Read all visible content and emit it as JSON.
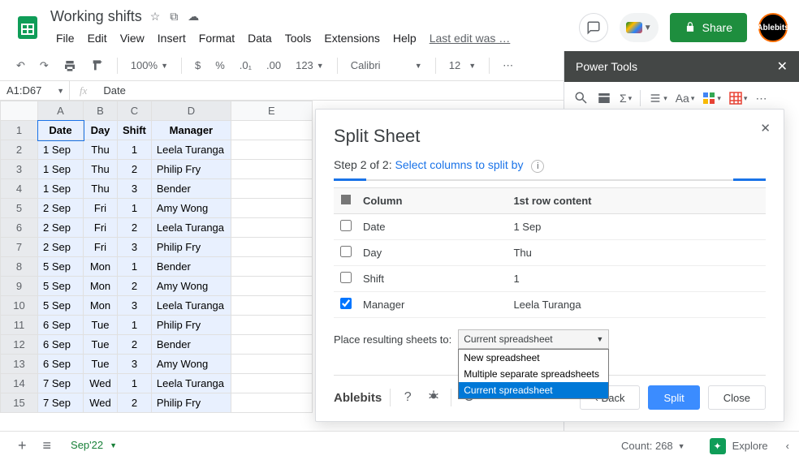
{
  "doc": {
    "title": "Working shifts",
    "last_edit": "Last edit was …"
  },
  "menubar": [
    "File",
    "Edit",
    "View",
    "Insert",
    "Format",
    "Data",
    "Tools",
    "Extensions",
    "Help"
  ],
  "share": "Share",
  "avatar": "Ablebits",
  "toolbar": {
    "zoom": "100%",
    "font": "Calibri",
    "size": "12",
    "currency": "$",
    "percent": "%",
    "dec_dec": ".0₁",
    "dec_inc": ".00",
    "numfmt": "123"
  },
  "fx": {
    "ref": "A1:D67",
    "value": "Date"
  },
  "columns": [
    "A",
    "B",
    "C",
    "D",
    "E"
  ],
  "headers": {
    "date": "Date",
    "day": "Day",
    "shift": "Shift",
    "manager": "Manager"
  },
  "rows": [
    {
      "date": "1 Sep",
      "day": "Thu",
      "shift": "1",
      "mgr": "Leela Turanga"
    },
    {
      "date": "1 Sep",
      "day": "Thu",
      "shift": "2",
      "mgr": "Philip Fry"
    },
    {
      "date": "1 Sep",
      "day": "Thu",
      "shift": "3",
      "mgr": "Bender"
    },
    {
      "date": "2 Sep",
      "day": "Fri",
      "shift": "1",
      "mgr": "Amy Wong"
    },
    {
      "date": "2 Sep",
      "day": "Fri",
      "shift": "2",
      "mgr": "Leela Turanga"
    },
    {
      "date": "2 Sep",
      "day": "Fri",
      "shift": "3",
      "mgr": "Philip Fry"
    },
    {
      "date": "5 Sep",
      "day": "Mon",
      "shift": "1",
      "mgr": "Bender"
    },
    {
      "date": "5 Sep",
      "day": "Mon",
      "shift": "2",
      "mgr": "Amy Wong"
    },
    {
      "date": "5 Sep",
      "day": "Mon",
      "shift": "3",
      "mgr": "Leela Turanga"
    },
    {
      "date": "6 Sep",
      "day": "Tue",
      "shift": "1",
      "mgr": "Philip Fry"
    },
    {
      "date": "6 Sep",
      "day": "Tue",
      "shift": "2",
      "mgr": "Bender"
    },
    {
      "date": "6 Sep",
      "day": "Tue",
      "shift": "3",
      "mgr": "Amy Wong"
    },
    {
      "date": "7 Sep",
      "day": "Wed",
      "shift": "1",
      "mgr": "Leela Turanga"
    },
    {
      "date": "7 Sep",
      "day": "Wed",
      "shift": "2",
      "mgr": "Philip Fry"
    }
  ],
  "sheet_tab": "Sep'22",
  "count_label": "Count: 268",
  "explore": "Explore",
  "sidebar": {
    "title": "Power Tools"
  },
  "panel": {
    "title": "Split Sheet",
    "step_prefix": "Step 2 of 2: ",
    "step_link": "Select columns to split by",
    "col_header": "Column",
    "content_header": "1st row content",
    "cols": [
      {
        "name": "Date",
        "content": "1 Sep",
        "checked": false
      },
      {
        "name": "Day",
        "content": "Thu",
        "checked": false
      },
      {
        "name": "Shift",
        "content": "1",
        "checked": false
      },
      {
        "name": "Manager",
        "content": "Leela Turanga",
        "checked": true
      }
    ],
    "place_label": "Place resulting sheets to:",
    "place_value": "Current spreadsheet",
    "options": [
      "New spreadsheet",
      "Multiple separate spreadsheets",
      "Current spreadsheet"
    ],
    "brand": "Ablebits",
    "back": "‹ Back",
    "split": "Split",
    "close": "Close"
  }
}
